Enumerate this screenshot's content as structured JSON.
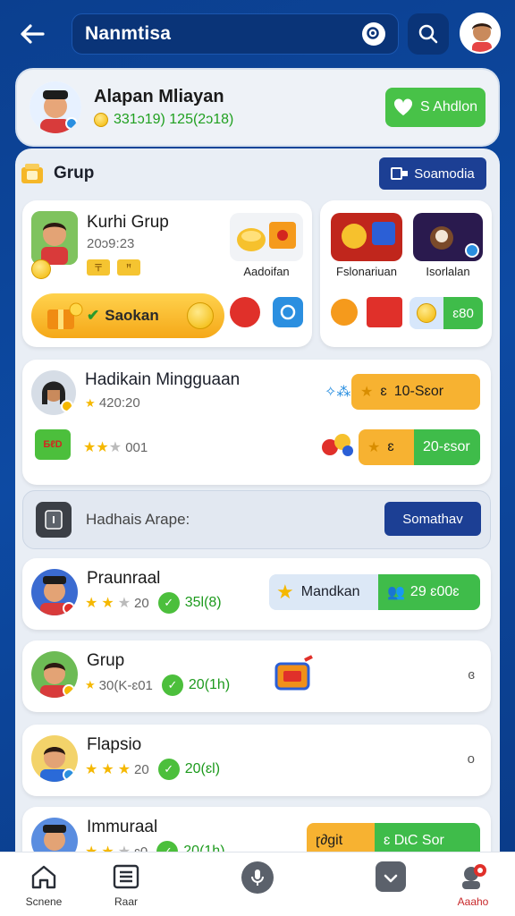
{
  "header": {
    "title": "Nanmtisa",
    "back_icon": "back-arrow-icon",
    "scan_icon": "scan-icon",
    "search_icon": "search-icon"
  },
  "profile": {
    "name": "Alapan Mliayan",
    "stats": "331ɔ19) 125(2ɔ18)",
    "button_label": "S Ahdlon"
  },
  "group_section": {
    "title": "Grup",
    "see_more_label": "Soamodia",
    "main_card": {
      "name": "Kurhi Grup",
      "date": "20ɔ9:23",
      "sticker_label": "Aadoifan",
      "claim_label": "Saokan"
    },
    "side_card": {
      "sticker1_label": "Fslonariuan",
      "sticker2_label": "Isorlalan",
      "score_label": "ɛ80"
    }
  },
  "weekly": {
    "title": "Hadikain Mingguaan",
    "score": "420:20",
    "rating_text": "001",
    "pill1_num": "ɛ",
    "pill1_value": "10-Sɛor",
    "pill2_num": "ɛ",
    "pill2_value": "20-ɛsor"
  },
  "achievement": {
    "label": "Hadhais Arape:",
    "button_label": "Somathav"
  },
  "list": [
    {
      "name": "Praunraal",
      "score": "20",
      "points": "35l(8)",
      "pill_label": "Mandkan",
      "pill_value": "29 ɛ00ɛ"
    },
    {
      "name": "Grup",
      "score": "30(K-ɛ01",
      "points": "20(1h)",
      "right_value": "ɞ"
    },
    {
      "name": "Flapsio",
      "score": "20",
      "points": "20(ɛl)",
      "right_value": "o"
    },
    {
      "name": "Immuraal",
      "score": "ɛ0",
      "points": "20(1h)",
      "pill_label": "ɽ∂git",
      "pill_value": "ɛ DɩC Sor"
    }
  ],
  "bottom_nav": [
    {
      "label": "Scnene",
      "icon": "home-icon"
    },
    {
      "label": "Raar",
      "icon": "list-icon"
    },
    {
      "label": "",
      "icon": "mic-icon"
    },
    {
      "label": "",
      "icon": "download-icon"
    },
    {
      "label": "Aaaho",
      "icon": "profile-icon"
    }
  ],
  "colors": {
    "brand_blue": "#0d4aa3",
    "green": "#48c248",
    "orange": "#f7b231",
    "navy_button": "#1c3f94"
  }
}
